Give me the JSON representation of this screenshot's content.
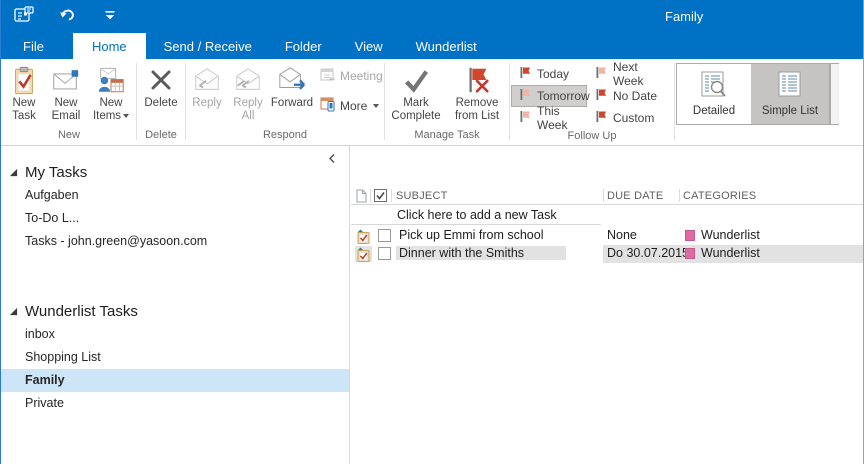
{
  "window": {
    "title": "Family"
  },
  "tabs": [
    {
      "label": "File"
    },
    {
      "label": "Home",
      "active": true
    },
    {
      "label": "Send / Receive"
    },
    {
      "label": "Folder"
    },
    {
      "label": "View"
    },
    {
      "label": "Wunderlist"
    }
  ],
  "ribbon": {
    "new": {
      "group_label": "New",
      "task": {
        "line1": "New",
        "line2": "Task"
      },
      "email": {
        "line1": "New",
        "line2": "Email"
      },
      "items": {
        "line1": "New",
        "line2": "Items"
      }
    },
    "delete": {
      "group_label": "Delete",
      "label": "Delete"
    },
    "respond": {
      "group_label": "Respond",
      "reply": "Reply",
      "reply_all_1": "Reply",
      "reply_all_2": "All",
      "forward": "Forward",
      "meeting": "Meeting",
      "more": "More"
    },
    "manage": {
      "group_label": "Manage Task",
      "mark": {
        "line1": "Mark",
        "line2": "Complete"
      },
      "remove": {
        "line1": "Remove",
        "line2": "from List"
      }
    },
    "followup": {
      "group_label": "Follow Up",
      "buttons": [
        {
          "label": "Today",
          "flag": "solid",
          "selected": false
        },
        {
          "label": "Tomorrow",
          "flag": "pale",
          "selected": true
        },
        {
          "label": "This Week",
          "flag": "pale",
          "selected": false
        },
        {
          "label": "Next Week",
          "flag": "pale",
          "selected": false
        },
        {
          "label": "No Date",
          "flag": "solid",
          "selected": false
        },
        {
          "label": "Custom",
          "flag": "solid",
          "selected": false
        }
      ]
    },
    "view": {
      "detailed": "Detailed",
      "simple_list": "Simple List",
      "selected": "Simple List"
    }
  },
  "sidebar": {
    "sections": [
      {
        "title": "My Tasks",
        "items": [
          {
            "label": "Aufgaben"
          },
          {
            "label": "To-Do L..."
          },
          {
            "label": "Tasks - john.green@yasoon.com"
          }
        ]
      },
      {
        "title": "Wunderlist Tasks",
        "items": [
          {
            "label": "inbox"
          },
          {
            "label": "Shopping List"
          },
          {
            "label": "Family",
            "selected": true
          },
          {
            "label": "Private"
          }
        ]
      }
    ]
  },
  "tasklist": {
    "columns": {
      "subject": "SUBJECT",
      "due_date": "DUE DATE",
      "categories": "CATEGORIES"
    },
    "add_row_text": "Click here to add a new Task",
    "rows": [
      {
        "subject": "Pick up Emmi from school",
        "due": "None",
        "category": "Wunderlist",
        "selected": false
      },
      {
        "subject": "Dinner with the Smiths",
        "due": "Do 30.07.2015",
        "category": "Wunderlist",
        "selected": true
      }
    ]
  },
  "icons": [
    "tasks-view-icon",
    "undo-icon",
    "customize-qat-icon",
    "new-task-icon",
    "new-email-icon",
    "new-items-icon",
    "delete-icon",
    "reply-icon",
    "reply-all-icon",
    "forward-icon",
    "meeting-icon",
    "more-icon",
    "mark-complete-icon",
    "remove-from-list-icon",
    "flag-icon",
    "detailed-view-icon",
    "simple-list-view-icon",
    "chevron-left-icon",
    "tree-expanded-icon",
    "page-icon",
    "checkbox-icon",
    "task-item-icon",
    "category-color-swatch"
  ],
  "colors": {
    "titlebar_blue": "#0072C6",
    "sidebar_selected": "#CDE6F7",
    "row_selected": "#E2E2E2",
    "category_pink": "#DF6AA4",
    "flag_red": "#CF4727",
    "flag_pale": "#F1B3A4"
  }
}
